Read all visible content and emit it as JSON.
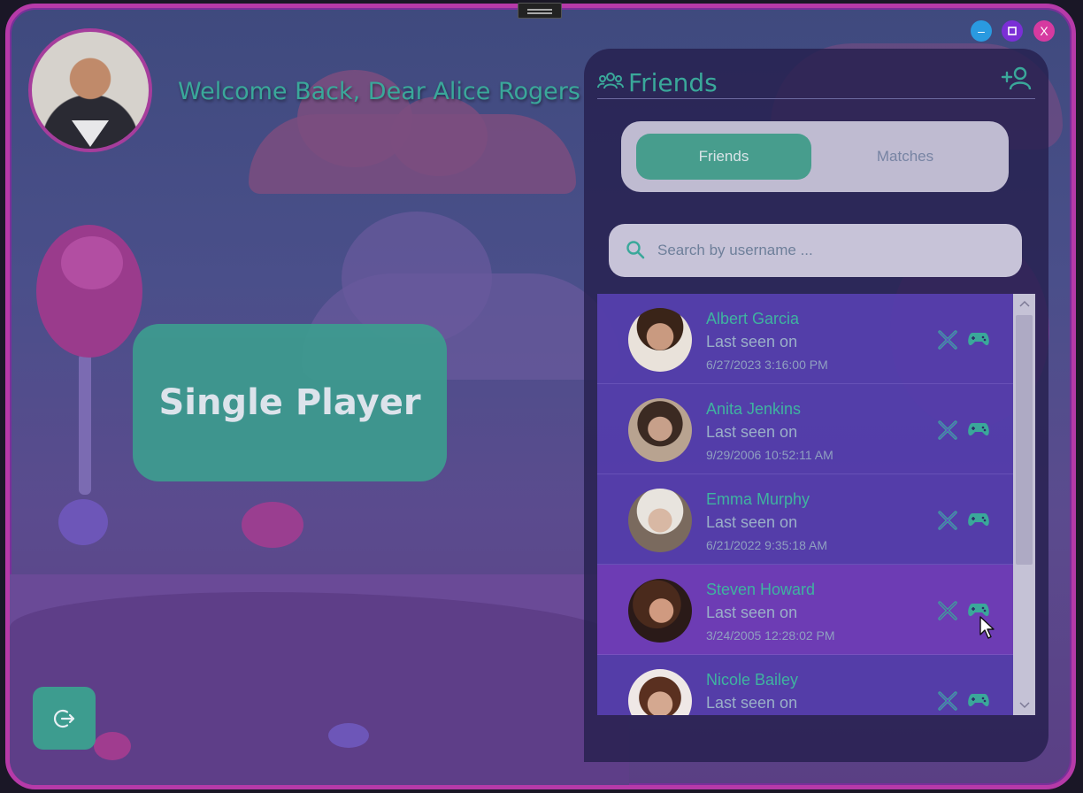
{
  "header": {
    "welcome_text": "Welcome Back, Dear Alice Rogers"
  },
  "main": {
    "single_player_label": "Single Player"
  },
  "window_controls": {
    "minimize": "–",
    "maximize": "▫",
    "close": "X"
  },
  "friends_panel": {
    "title": "Friends",
    "tabs": [
      {
        "label": "Friends",
        "selected": true
      },
      {
        "label": "Matches",
        "selected": false
      }
    ],
    "search": {
      "placeholder": "Search by username ..."
    },
    "friends": [
      {
        "name": "Albert Garcia",
        "status": "Last seen on",
        "date": "6/27/2023 3:16:00 PM"
      },
      {
        "name": "Anita Jenkins",
        "status": "Last seen on",
        "date": "9/29/2006 10:52:11 AM"
      },
      {
        "name": "Emma Murphy",
        "status": "Last seen on",
        "date": "6/21/2022 9:35:18 AM"
      },
      {
        "name": "Steven Howard",
        "status": "Last seen on",
        "date": "3/24/2005 12:28:02 PM"
      },
      {
        "name": "Nicole Bailey",
        "status": "Last seen on",
        "date": ""
      }
    ]
  },
  "colors": {
    "accent": "#3aa89a",
    "window_border": "#b63aa8",
    "panel_bg": "#26204e",
    "list_bg": "#6246c8"
  },
  "icons": [
    "friends-icon",
    "add-friend-icon",
    "search-icon",
    "remove-friend-icon",
    "gamepad-icon",
    "logout-icon",
    "chevron-up-icon",
    "chevron-down-icon"
  ]
}
